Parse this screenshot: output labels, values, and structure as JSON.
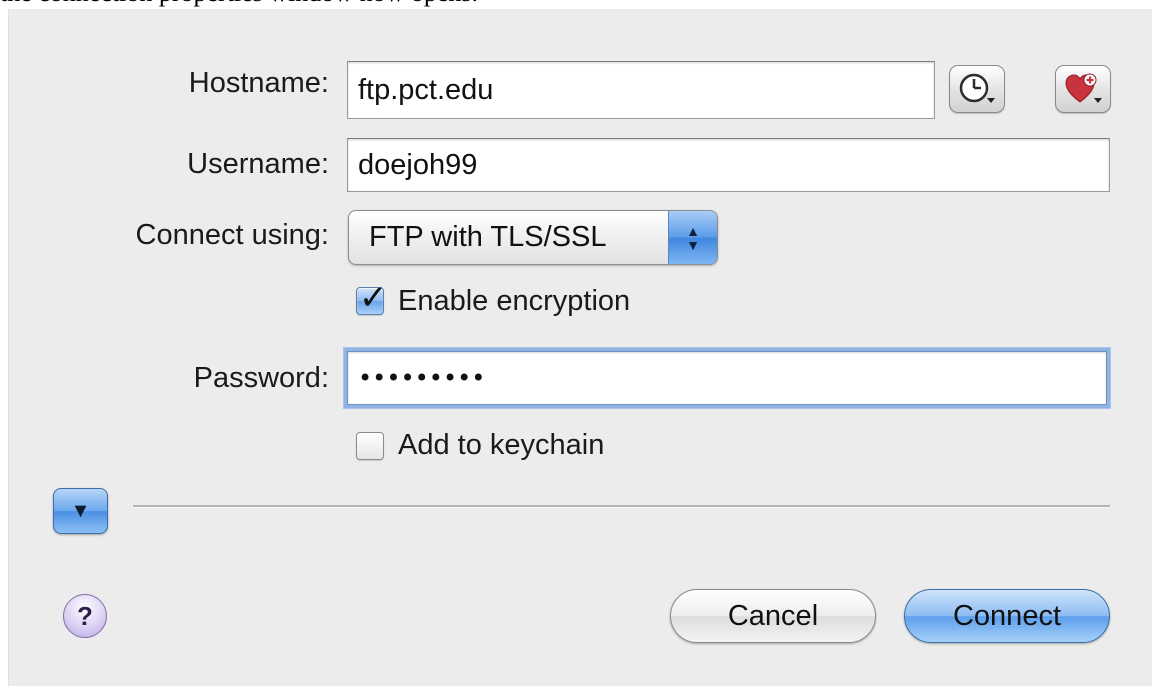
{
  "caption": "the connection properties window now opens.",
  "form": {
    "hostname_label": "Hostname:",
    "hostname_value": "ftp.pct.edu",
    "username_label": "Username:",
    "username_value": "doejoh99",
    "connect_using_label": "Connect using:",
    "connect_using_value": "FTP with TLS/SSL",
    "enable_encryption_label": "Enable encryption",
    "enable_encryption_checked": true,
    "password_label": "Password:",
    "password_value": "•••••••••",
    "add_to_keychain_label": "Add to keychain",
    "add_to_keychain_checked": false
  },
  "icons": {
    "history": "clock-icon",
    "favorites": "heart-plus-icon",
    "disclosure": "triangle-down-icon",
    "help": "help-icon"
  },
  "help_label": "?",
  "buttons": {
    "cancel_label": "Cancel",
    "connect_label": "Connect"
  },
  "colors": {
    "accent": "#5d9fec",
    "window_bg": "#ececec",
    "help_purple": "#b6a4e2"
  }
}
